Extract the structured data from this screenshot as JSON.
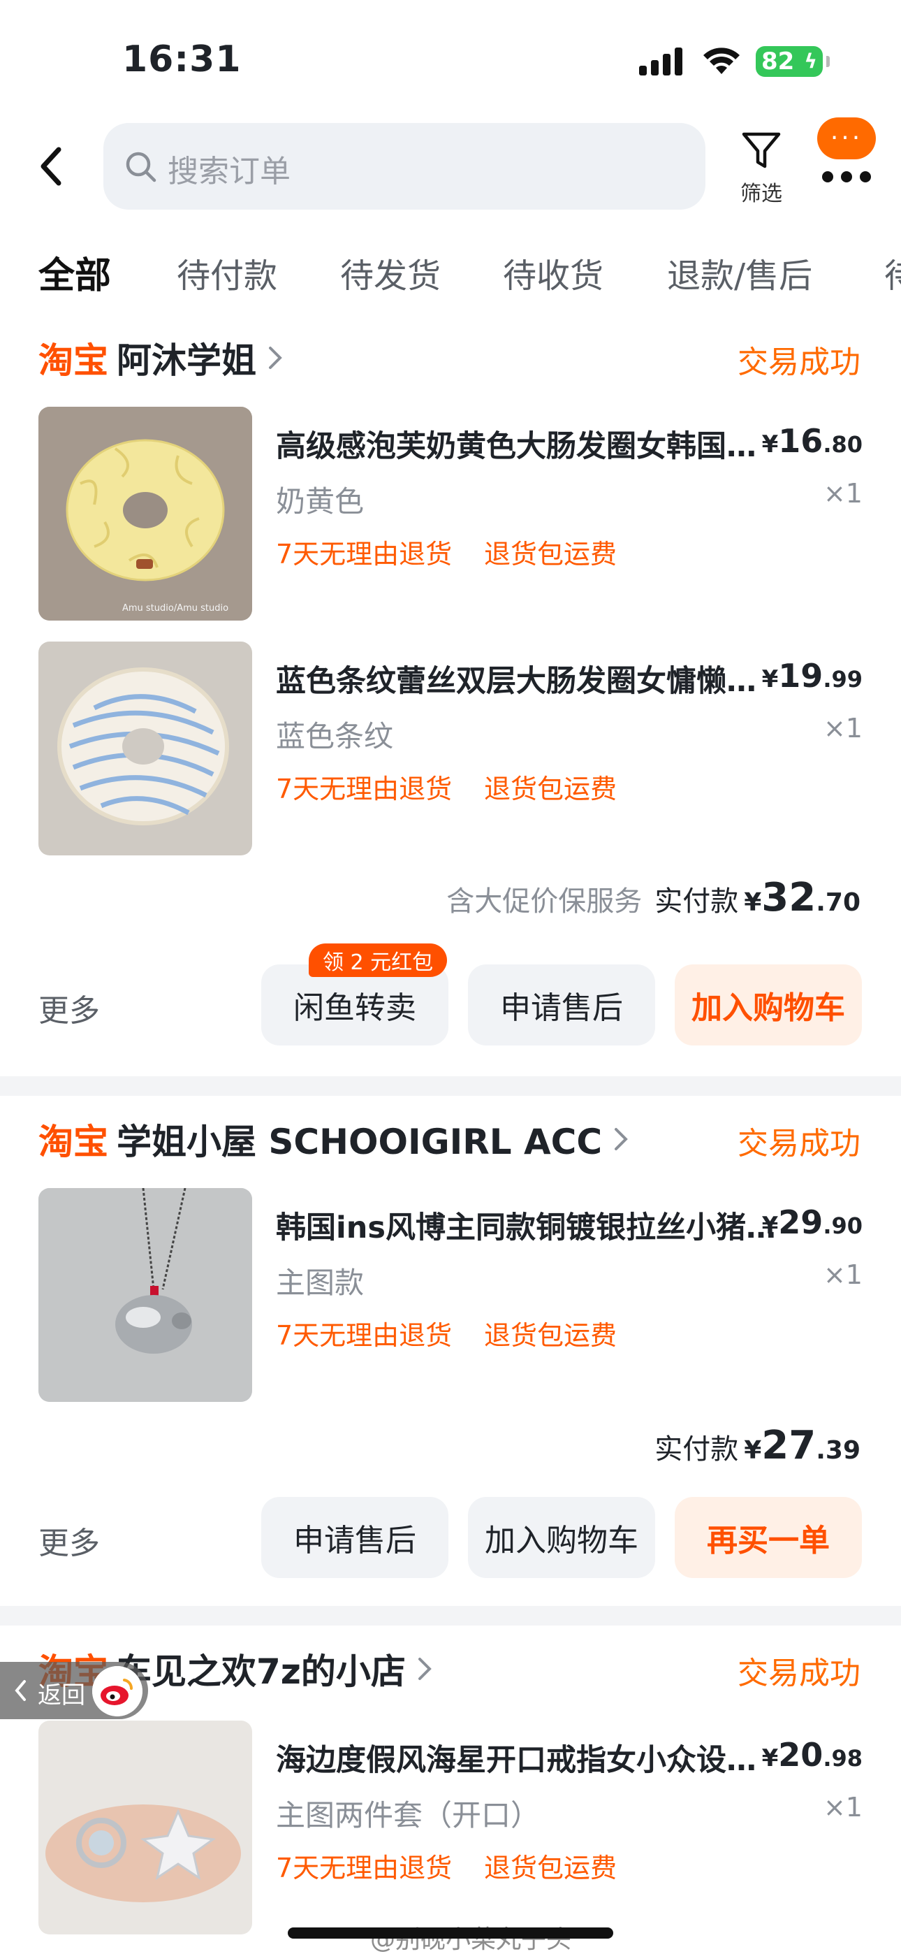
{
  "status_bar": {
    "time": "16:31",
    "battery": "82"
  },
  "search": {
    "placeholder": "搜索订单",
    "filter_label": "筛选",
    "msg_dots": "···"
  },
  "tabs": [
    "全部",
    "待付款",
    "待发货",
    "待收货",
    "退款/售后",
    "待"
  ],
  "orders": [
    {
      "platform": "淘宝",
      "shop": "阿沐学姐",
      "status": "交易成功",
      "items": [
        {
          "title": "高级感泡芙奶黄色大肠发圈女韩国扎头发头绳",
          "variant": "奶黄色",
          "price_sym": "¥",
          "price_int": "16",
          "price_dec": ".80",
          "qty": "×1",
          "tag1": "7天无理由退货",
          "tag2": "退货包运费",
          "thumb_caption": "Amu studio/Amu studio"
        },
        {
          "title": "蓝色条纹蕾丝双层大肠发圈女慵懒风发绳头绳",
          "variant": "蓝色条纹",
          "price_sym": "¥",
          "price_int": "19",
          "price_dec": ".99",
          "qty": "×1",
          "tag1": "7天无理由退货",
          "tag2": "退货包运费"
        }
      ],
      "total_note": "含大促价保服务",
      "total_label": "实付款",
      "total_sym": "¥",
      "total_int": "32",
      "total_dec": ".70",
      "more": "更多",
      "promo": "领 2 元红包",
      "buttons": [
        "闲鱼转卖",
        "申请售后",
        "加入购物车"
      ]
    },
    {
      "platform": "淘宝",
      "shop": "学姐小屋 SCHOOIGIRL ACC",
      "status": "交易成功",
      "items": [
        {
          "title": "韩国ins风博主同款铜镀银拉丝小猪项链吊坠",
          "variant": "主图款",
          "price_sym": "¥",
          "price_int": "29",
          "price_dec": ".90",
          "qty": "×1",
          "tag1": "7天无理由退货",
          "tag2": "退货包运费"
        }
      ],
      "total_label": "实付款",
      "total_sym": "¥",
      "total_int": "27",
      "total_dec": ".39",
      "more": "更多",
      "buttons": [
        "申请售后",
        "加入购物车",
        "再买一单"
      ]
    },
    {
      "platform": "淘宝",
      "shop": "车见之欢7z的小店",
      "status": "交易成功",
      "items": [
        {
          "title": "海边度假风海星开口戒指女小众设计感",
          "variant": "主图两件套（开口）",
          "price_sym": "¥",
          "price_int": "20",
          "price_dec": ".98",
          "qty": "×1",
          "tag1": "7天无理由退货",
          "tag2": "退货包运费"
        }
      ]
    }
  ],
  "overlay": {
    "return_label": "返回",
    "watermark": "@别砚小菜丸子头"
  },
  "colors": {
    "accent": "#ff5000",
    "status_orange": "#ff6a00",
    "battery_green": "#34c759"
  }
}
